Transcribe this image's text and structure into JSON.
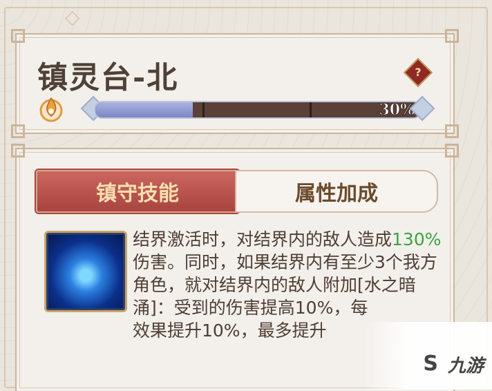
{
  "header": {
    "title": "镇灵台-北",
    "help_label": "?",
    "progress": {
      "value": 0.3,
      "label": "30%"
    },
    "icons": {
      "flame": "flame-icon",
      "help": "question-icon"
    }
  },
  "tabs": [
    {
      "label": "镇守技能",
      "active": true
    },
    {
      "label": "属性加成",
      "active": false
    }
  ],
  "skill": {
    "icon": "water-swirl-icon",
    "desc_1": "结界激活时，对结界内的敌人造成",
    "highlight": "130%",
    "desc_2": "伤害。同时，如果结界内有至少3个我方角色，就对结界内的敌人附加[水之暗涌]：受到的伤害提高10%，每",
    "desc_3": "效果提升10%，最多提升"
  },
  "watermark": {
    "logo": "S",
    "text": "九游"
  },
  "colors": {
    "accent_red": "#a8443f",
    "highlight_green": "#3aa340",
    "progress_fill": "#8d96d0"
  }
}
